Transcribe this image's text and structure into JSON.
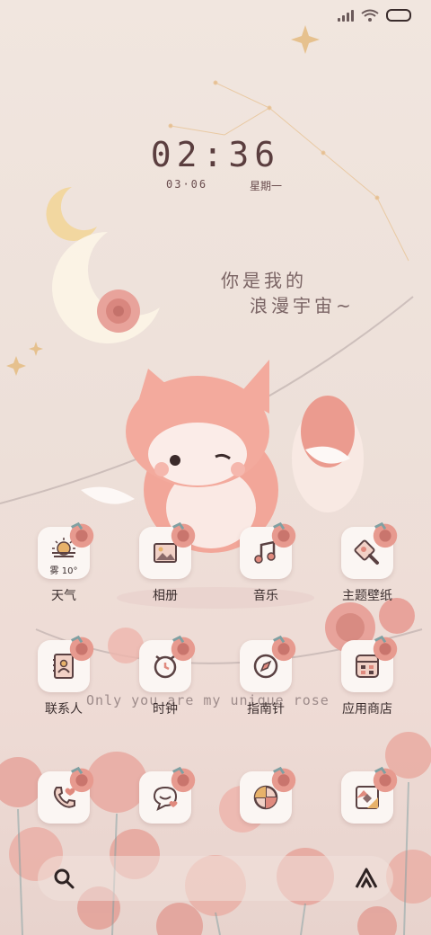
{
  "status_bar": {
    "signal_icon": "signal-icon",
    "wifi_icon": "wifi-icon",
    "battery_icon": "battery-icon"
  },
  "clock": {
    "time": "02:36",
    "date": "03·06",
    "weekday": "星期一"
  },
  "wallpaper": {
    "quote_line1": "你是我的",
    "quote_line2": "浪漫宇宙~",
    "slogan": "Only you are my unique rose"
  },
  "apps_row1": [
    {
      "label": "天气",
      "icon": "weather-icon",
      "temp": "雾 10°"
    },
    {
      "label": "相册",
      "icon": "gallery-icon"
    },
    {
      "label": "音乐",
      "icon": "music-icon"
    },
    {
      "label": "主题壁纸",
      "icon": "theme-icon"
    }
  ],
  "apps_row2": [
    {
      "label": "联系人",
      "icon": "contacts-icon"
    },
    {
      "label": "时钟",
      "icon": "clock-icon"
    },
    {
      "label": "指南针",
      "icon": "compass-icon"
    },
    {
      "label": "应用商店",
      "icon": "app-store-icon"
    }
  ],
  "dock": [
    {
      "icon": "phone-icon"
    },
    {
      "icon": "messages-icon"
    },
    {
      "icon": "browser-icon"
    },
    {
      "icon": "camera-icon"
    }
  ],
  "search_bar": {
    "search_icon": "search-icon",
    "assistant_icon": "assistant-icon"
  },
  "colors": {
    "accent": "#e08a7e",
    "icon_stroke": "#5a4142",
    "tile": "#fbf6f3"
  }
}
